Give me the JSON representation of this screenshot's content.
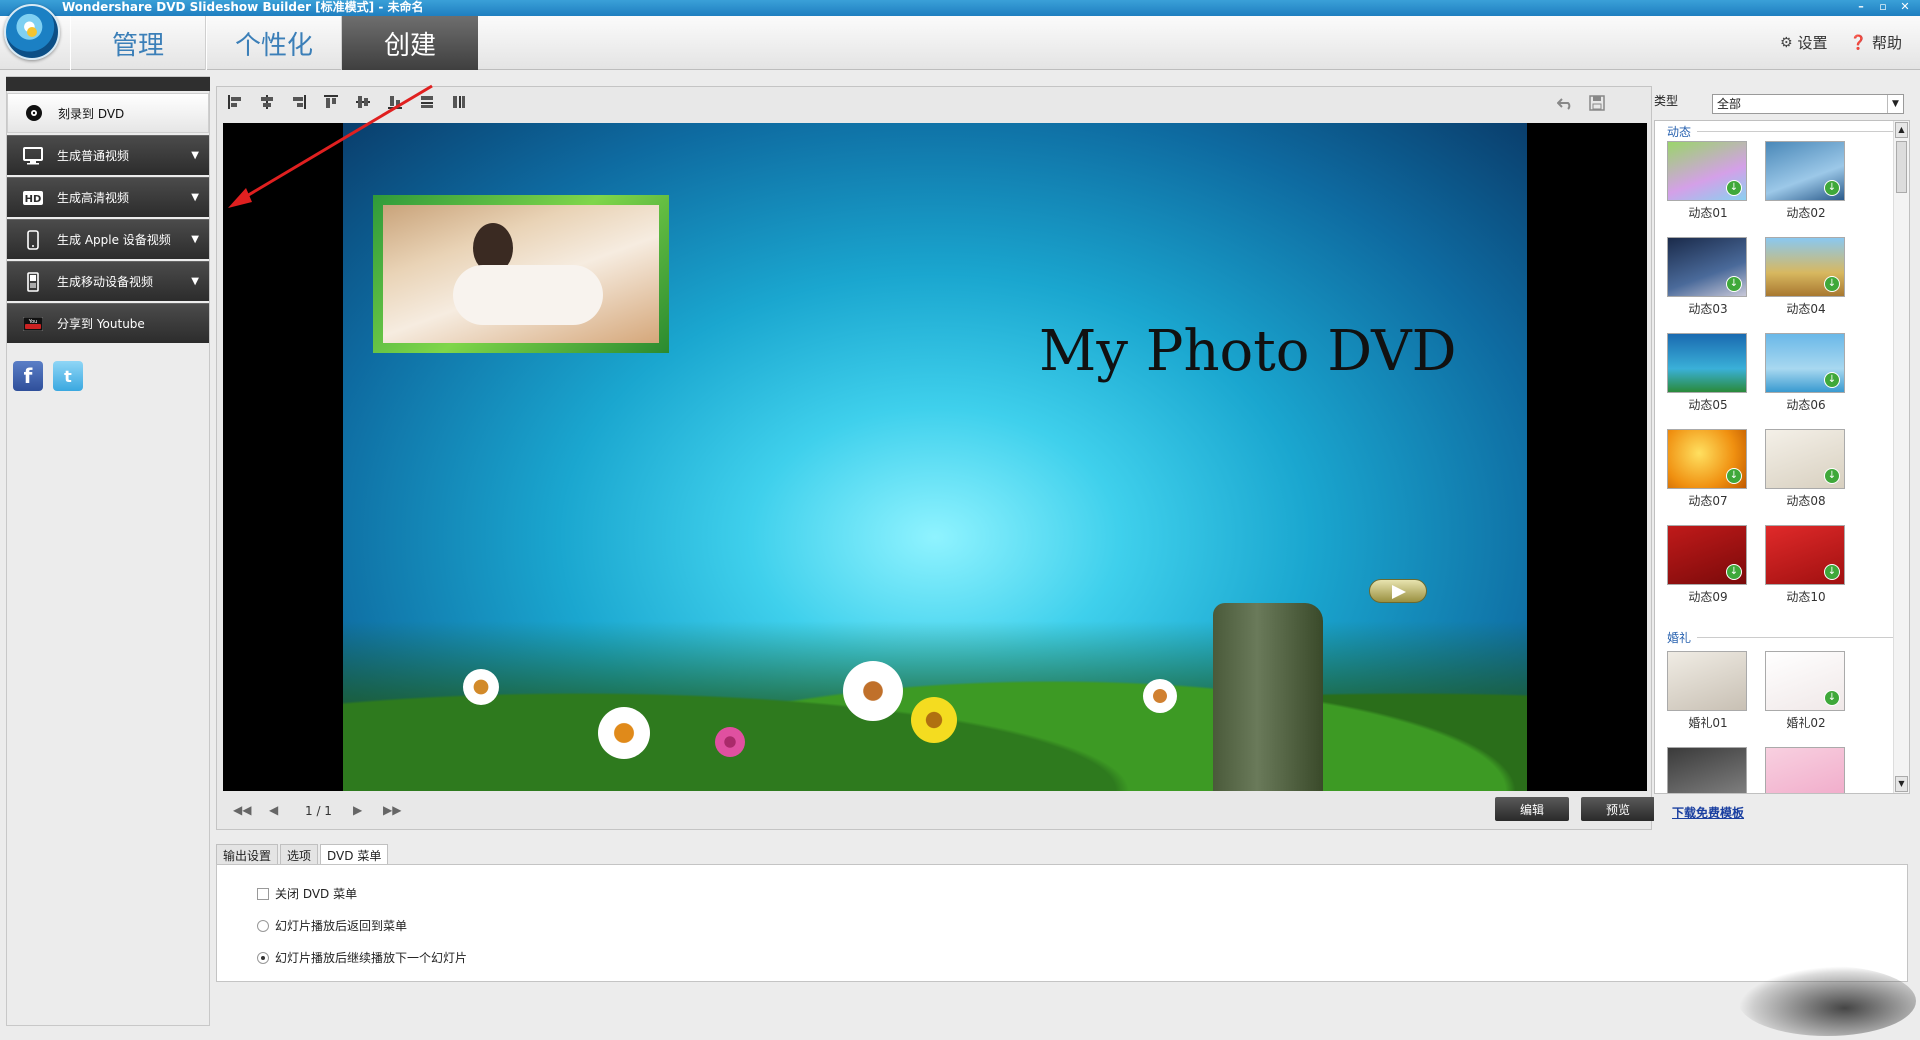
{
  "window": {
    "title": "Wondershare DVD Slideshow Builder [标准模式] - 未命名",
    "controls": [
      "–",
      "▫",
      "✕"
    ]
  },
  "nav": {
    "tabs": [
      {
        "label": "管理",
        "active": false
      },
      {
        "label": "个性化",
        "active": false
      },
      {
        "label": "创建",
        "active": true
      }
    ],
    "settings_label": "设置",
    "help_label": "帮助"
  },
  "sidebar": {
    "items": [
      {
        "label": "刻录到 DVD",
        "icon": "disc-icon",
        "has_dropdown": false
      },
      {
        "label": "生成普通视频",
        "icon": "monitor-icon",
        "has_dropdown": true
      },
      {
        "label": "生成高清视频",
        "icon": "hd-icon",
        "has_dropdown": true
      },
      {
        "label": "生成 Apple 设备视频",
        "icon": "phone-icon",
        "has_dropdown": true
      },
      {
        "label": "生成移动设备视频",
        "icon": "mobile-icon",
        "has_dropdown": true
      },
      {
        "label": "分享到 Youtube",
        "icon": "youtube-icon",
        "has_dropdown": false
      }
    ],
    "socials": [
      "facebook-icon",
      "twitter-icon"
    ]
  },
  "preview": {
    "dvd_title": "My Photo DVD",
    "page_info": "1 / 1",
    "edit_label": "编辑",
    "preview_label": "预览"
  },
  "templates": {
    "type_label": "类型",
    "type_value": "全部",
    "sections": [
      {
        "name": "动态",
        "items": [
          "动态01",
          "动态02",
          "动态03",
          "动态04",
          "动态05",
          "动态06",
          "动态07",
          "动态08",
          "动态09",
          "动态10"
        ]
      },
      {
        "name": "婚礼",
        "items": [
          "婚礼01",
          "婚礼02"
        ]
      }
    ],
    "download_link": "下载免费模板"
  },
  "options": {
    "tabs": [
      {
        "label": "输出设置",
        "active": false
      },
      {
        "label": "选项",
        "active": false
      },
      {
        "label": "DVD 菜单",
        "active": true
      }
    ],
    "close_menu_label": "关闭 DVD 菜单",
    "return_menu_label": "幻灯片播放后返回到菜单",
    "continue_label": "幻灯片播放后继续播放下一个幻灯片"
  },
  "colors": {
    "accent_blue": "#3b7fb8",
    "active_tab": "#4a4a4a",
    "annotation_red": "#e02020"
  }
}
